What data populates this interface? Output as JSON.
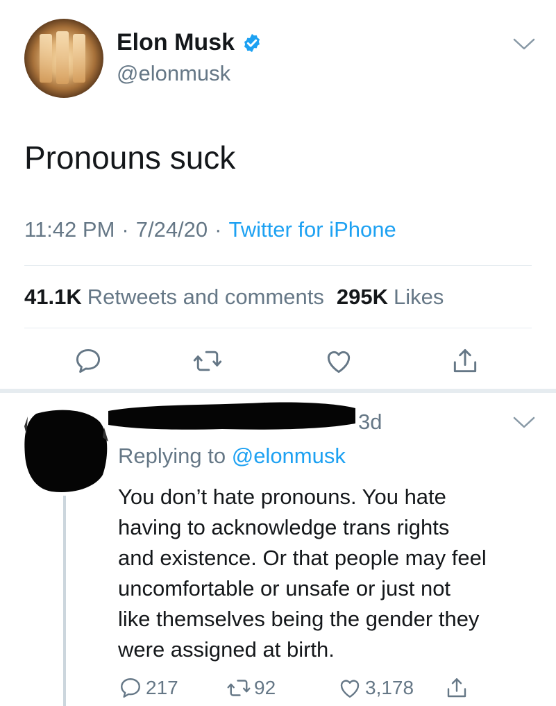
{
  "tweet": {
    "author_name": "Elon Musk",
    "author_handle": "@elonmusk",
    "text": "Pronouns suck",
    "time": "11:42 PM",
    "date": "7/24/20",
    "separator": "·",
    "source": "Twitter for iPhone",
    "retweets_count": "41.1K",
    "retweets_label": "Retweets and comments",
    "likes_count": "295K",
    "likes_label": "Likes"
  },
  "reply": {
    "time": "3d",
    "replying_prefix": "Replying to",
    "replying_to": "@elonmusk",
    "text": "You don’t hate pronouns. You hate\nhaving to acknowledge trans rights\nand existence. Or that people may feel\nuncomfortable or unsafe or just not\nlike themselves being the gender they\nwere assigned at birth.",
    "reply_count": "217",
    "retweet_count": "92",
    "like_count": "3,178"
  },
  "colors": {
    "text": "#14171a",
    "secondary": "#657786",
    "link": "#1da1f2",
    "divider": "#e6ecf0"
  },
  "icons": [
    "verified-icon",
    "chevron-down-icon",
    "reply-icon",
    "retweet-icon",
    "like-icon",
    "share-icon"
  ]
}
